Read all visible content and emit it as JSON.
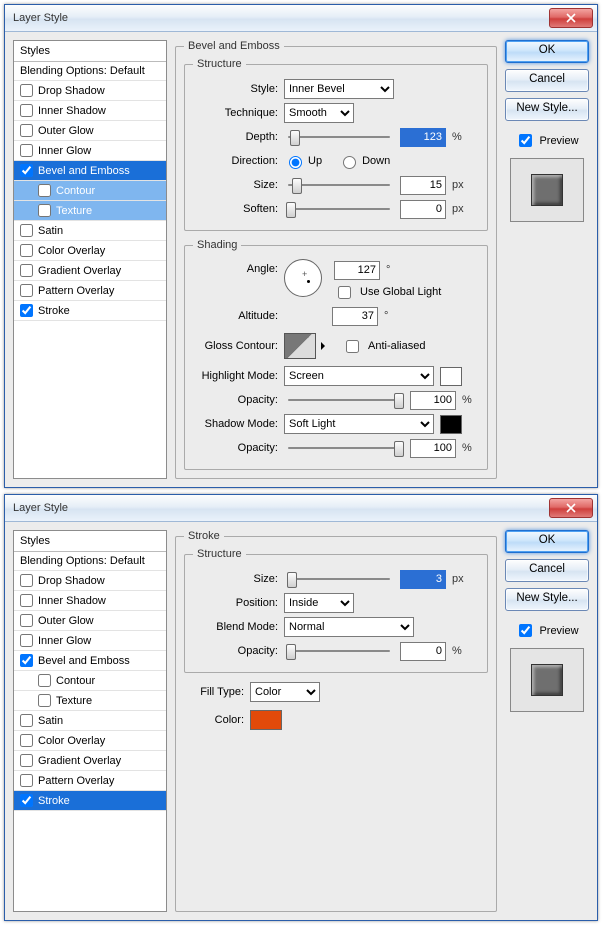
{
  "dialogs": [
    {
      "title": "Layer Style",
      "stylesHeader": "Styles",
      "blendingOptions": "Blending Options: Default",
      "styleItems": [
        {
          "label": "Drop Shadow",
          "checked": false,
          "sub": false,
          "selected": false
        },
        {
          "label": "Inner Shadow",
          "checked": false,
          "sub": false,
          "selected": false
        },
        {
          "label": "Outer Glow",
          "checked": false,
          "sub": false,
          "selected": false
        },
        {
          "label": "Inner Glow",
          "checked": false,
          "sub": false,
          "selected": false
        },
        {
          "label": "Bevel and Emboss",
          "checked": true,
          "sub": false,
          "selected": true
        },
        {
          "label": "Contour",
          "checked": false,
          "sub": true,
          "selected": true
        },
        {
          "label": "Texture",
          "checked": false,
          "sub": true,
          "selected": true
        },
        {
          "label": "Satin",
          "checked": false,
          "sub": false,
          "selected": false
        },
        {
          "label": "Color Overlay",
          "checked": false,
          "sub": false,
          "selected": false
        },
        {
          "label": "Gradient Overlay",
          "checked": false,
          "sub": false,
          "selected": false
        },
        {
          "label": "Pattern Overlay",
          "checked": false,
          "sub": false,
          "selected": false
        },
        {
          "label": "Stroke",
          "checked": true,
          "sub": false,
          "selected": false
        }
      ],
      "section": {
        "title": "Bevel and Emboss",
        "structure": {
          "legend": "Structure",
          "styleLabel": "Style:",
          "styleValue": "Inner Bevel",
          "techLabel": "Technique:",
          "techValue": "Smooth",
          "depthLabel": "Depth:",
          "depthValue": "123",
          "depthUnit": "%",
          "directionLabel": "Direction:",
          "up": "Up",
          "down": "Down",
          "sizeLabel": "Size:",
          "sizeValue": "15",
          "sizeUnit": "px",
          "softenLabel": "Soften:",
          "softenValue": "0",
          "softenUnit": "px"
        },
        "shading": {
          "legend": "Shading",
          "angleLabel": "Angle:",
          "angleValue": "127",
          "degree": "°",
          "useGlobal": "Use Global Light",
          "altitudeLabel": "Altitude:",
          "altitudeValue": "37",
          "glossLabel": "Gloss Contour:",
          "antiAliased": "Anti-aliased",
          "hlModeLabel": "Highlight Mode:",
          "hlModeValue": "Screen",
          "opacityLabel": "Opacity:",
          "hlOpacity": "100",
          "shModeLabel": "Shadow Mode:",
          "shModeValue": "Soft Light",
          "shOpacity": "100",
          "pct": "%"
        }
      },
      "buttons": {
        "ok": "OK",
        "cancel": "Cancel",
        "newStyle": "New Style...",
        "preview": "Preview"
      }
    },
    {
      "title": "Layer Style",
      "stylesHeader": "Styles",
      "blendingOptions": "Blending Options: Default",
      "styleItems": [
        {
          "label": "Drop Shadow",
          "checked": false,
          "sub": false,
          "selected": false
        },
        {
          "label": "Inner Shadow",
          "checked": false,
          "sub": false,
          "selected": false
        },
        {
          "label": "Outer Glow",
          "checked": false,
          "sub": false,
          "selected": false
        },
        {
          "label": "Inner Glow",
          "checked": false,
          "sub": false,
          "selected": false
        },
        {
          "label": "Bevel and Emboss",
          "checked": true,
          "sub": false,
          "selected": false
        },
        {
          "label": "Contour",
          "checked": false,
          "sub": true,
          "selected": false
        },
        {
          "label": "Texture",
          "checked": false,
          "sub": true,
          "selected": false
        },
        {
          "label": "Satin",
          "checked": false,
          "sub": false,
          "selected": false
        },
        {
          "label": "Color Overlay",
          "checked": false,
          "sub": false,
          "selected": false
        },
        {
          "label": "Gradient Overlay",
          "checked": false,
          "sub": false,
          "selected": false
        },
        {
          "label": "Pattern Overlay",
          "checked": false,
          "sub": false,
          "selected": false
        },
        {
          "label": "Stroke",
          "checked": true,
          "sub": false,
          "selected": true
        }
      ],
      "section": {
        "title": "Stroke",
        "structure": {
          "legend": "Structure",
          "sizeLabel": "Size:",
          "sizeValue": "3",
          "sizeUnit": "px",
          "positionLabel": "Position:",
          "positionValue": "Inside",
          "blendLabel": "Blend Mode:",
          "blendValue": "Normal",
          "opacityLabel": "Opacity:",
          "opacityValue": "0",
          "pct": "%"
        },
        "fill": {
          "fillTypeLabel": "Fill Type:",
          "fillTypeValue": "Color",
          "colorLabel": "Color:",
          "colorHex": "#e24a0a"
        }
      },
      "buttons": {
        "ok": "OK",
        "cancel": "Cancel",
        "newStyle": "New Style...",
        "preview": "Preview"
      }
    }
  ]
}
